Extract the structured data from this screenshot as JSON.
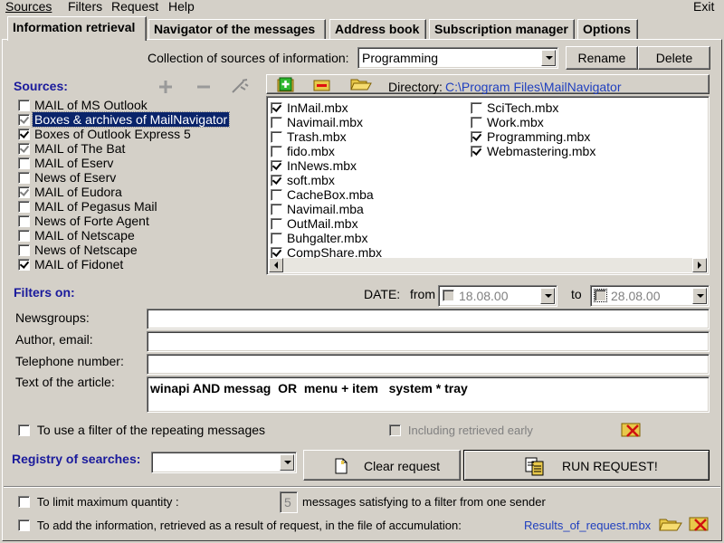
{
  "menu": {
    "sources": "Sources",
    "filters": "Filters",
    "request": "Request",
    "help": "Help",
    "exit": "Exit"
  },
  "tabs": [
    {
      "label": "Information retrieval",
      "active": true
    },
    {
      "label": "Navigator of the messages",
      "active": false
    },
    {
      "label": "Address book",
      "active": false
    },
    {
      "label": "Subscription manager",
      "active": false
    },
    {
      "label": "Options",
      "active": false
    }
  ],
  "collection": {
    "label": "Collection of sources of information:",
    "value": "Programming",
    "rename_label": "Rename",
    "delete_label": "Delete"
  },
  "sources": {
    "title": "Sources:",
    "add_icon": "plus-icon",
    "remove_icon": "minus-icon",
    "wizard_icon": "wand-icon",
    "items": [
      {
        "label": "MAIL of MS Outlook",
        "checked": false,
        "grey": false
      },
      {
        "label": "Boxes & archives of MailNavigator",
        "checked": true,
        "grey": true,
        "selected": true
      },
      {
        "label": "Boxes of Outlook Express 5",
        "checked": true,
        "grey": false
      },
      {
        "label": "MAIL of The Bat",
        "checked": true,
        "grey": true
      },
      {
        "label": "MAIL of Eserv",
        "checked": false,
        "grey": false
      },
      {
        "label": "News of Eserv",
        "checked": false,
        "grey": false
      },
      {
        "label": "MAIL of Eudora",
        "checked": true,
        "grey": true
      },
      {
        "label": "MAIL of Pegasus Mail",
        "checked": false,
        "grey": false
      },
      {
        "label": "News of Forte Agent",
        "checked": false,
        "grey": false
      },
      {
        "label": "MAIL of Netscape",
        "checked": false,
        "grey": false
      },
      {
        "label": "News of Netscape",
        "checked": false,
        "grey": false
      },
      {
        "label": "MAIL of Fidonet",
        "checked": true,
        "grey": false
      }
    ]
  },
  "files": {
    "directory_label": "Directory:",
    "directory_path": "C:\\Program Files\\MailNavigator",
    "col1": [
      {
        "label": "InMail.mbx",
        "checked": true
      },
      {
        "label": "Navimail.mbx",
        "checked": false
      },
      {
        "label": "Trash.mbx",
        "checked": false
      },
      {
        "label": "fido.mbx",
        "checked": false
      },
      {
        "label": "InNews.mbx",
        "checked": true
      },
      {
        "label": "soft.mbx",
        "checked": true
      },
      {
        "label": "CacheBox.mba",
        "checked": false
      },
      {
        "label": "Navimail.mba",
        "checked": false
      },
      {
        "label": "OutMail.mbx",
        "checked": false
      },
      {
        "label": "Buhgalter.mbx",
        "checked": false
      },
      {
        "label": "CompShare.mbx",
        "checked": true
      }
    ],
    "col2": [
      {
        "label": "SciTech.mbx",
        "checked": false
      },
      {
        "label": "Work.mbx",
        "checked": false
      },
      {
        "label": "Programming.mbx",
        "checked": true
      },
      {
        "label": "Webmastering.mbx",
        "checked": true
      }
    ]
  },
  "filters": {
    "title": "Filters on:",
    "date_label": "DATE:",
    "from_label": "from",
    "from_value": "18.08.00",
    "to_label": "to",
    "to_value": "28.08.00",
    "newsgroups_label": "Newsgroups:",
    "author_label": "Author, email:",
    "phone_label": "Telephone number:",
    "article_label": "Text of the article:",
    "article_value": "winapi AND messag  OR  menu + item   system * tray",
    "repeat_filter_label": "To use a filter of the repeating messages",
    "including_label": "Including retrieved early"
  },
  "registry": {
    "title": "Registry of searches:",
    "clear_label": "Clear request",
    "run_label": "RUN REQUEST!"
  },
  "bottom": {
    "limit_label": "To limit maximum quantity :",
    "limit_value": "5",
    "limit_suffix": "messages satisfying to a filter from one sender",
    "accumulate_label": "To add the information, retrieved as a result of request, in the file of accumulation:",
    "accumulate_file": "Results_of_request.mbx"
  },
  "colors": {
    "face": "#d4d0c8",
    "title_blue": "#1a1a9c",
    "selection": "#0a246a",
    "link_blue": "#1f3fbf"
  }
}
